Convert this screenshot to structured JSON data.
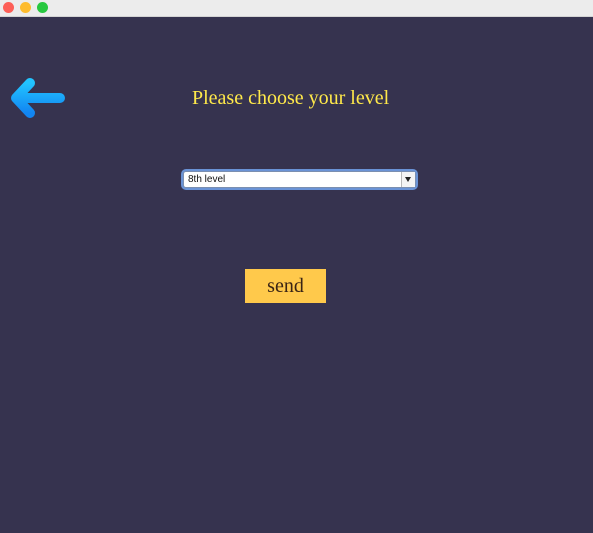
{
  "window": {
    "controls": [
      "close",
      "minimize",
      "zoom"
    ]
  },
  "back_button": {
    "icon": "arrow-left-icon",
    "color": "#1aa7ff"
  },
  "heading": {
    "text": "Please choose your level"
  },
  "level_select": {
    "selected": "8th level"
  },
  "send_button": {
    "label": "send"
  },
  "colors": {
    "background": "#36334f",
    "heading": "#ffe94a",
    "button": "#ffc94b"
  }
}
